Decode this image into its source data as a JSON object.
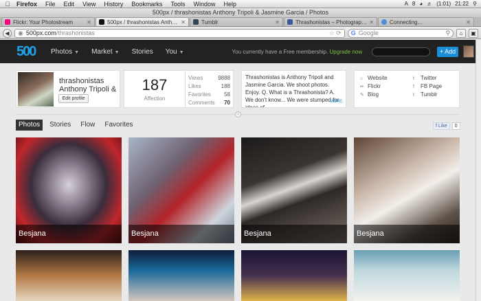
{
  "menubar": {
    "items": [
      "Firefox",
      "File",
      "Edit",
      "View",
      "History",
      "Bookmarks",
      "Tools",
      "Window",
      "Help"
    ],
    "status": [
      "A",
      "8",
      "(1:01)",
      "21:22"
    ]
  },
  "window_title": "500px / thrashonistas Anthony Tripoli & Jasmine Garcia / Photos",
  "tabs": [
    {
      "label": "Flickr: Your Photostream",
      "color": "#ff0084"
    },
    {
      "label": "500px / thrashonistas Anthony ...",
      "color": "#111111"
    },
    {
      "label": "Tumblr",
      "color": "#35465c"
    },
    {
      "label": "Thrashonistas – Photography",
      "color": "#3b5998"
    },
    {
      "label": "Connecting...",
      "color": "#4a90d9"
    }
  ],
  "urlbar": {
    "host": "500px.com",
    "path": "/thrashonistas"
  },
  "searchbar": {
    "placeholder": "Google"
  },
  "site": {
    "logo": "500",
    "nav": [
      "Photos",
      "Market",
      "Stories",
      "You"
    ],
    "membership": "You currently have a Free membership.",
    "upgrade": "Upgrade now",
    "add_label": "Add"
  },
  "profile": {
    "name": "thrashonistas Anthony Tripoli &",
    "edit_label": "Edit profile",
    "affection_value": "187",
    "affection_label": "Affection",
    "stats": [
      {
        "label": "Views",
        "value": "9888"
      },
      {
        "label": "Likes",
        "value": "188"
      },
      {
        "label": "Favorites",
        "value": "58"
      },
      {
        "label": "Comments",
        "value": "70"
      }
    ],
    "bio": "Thrashonistas is Anthony Tripoli and Jasmine Garcia. We shoot photos. Enjoy. Q. What is a Thrashonista? A. We don't know... We were stumped for ideas of",
    "more": "MORE",
    "links_left": [
      "Website",
      "Flickr",
      "Blog"
    ],
    "links_right": [
      "Twitter",
      "FB Page",
      "Tumblr"
    ]
  },
  "profile_tabs": [
    "Photos",
    "Stories",
    "Flow",
    "Favorites"
  ],
  "fb": {
    "like": "Like",
    "count": "0"
  },
  "photos": [
    {
      "caption": "Besjana"
    },
    {
      "caption": "Besjana"
    },
    {
      "caption": "Besjana"
    },
    {
      "caption": "Besjana"
    }
  ]
}
